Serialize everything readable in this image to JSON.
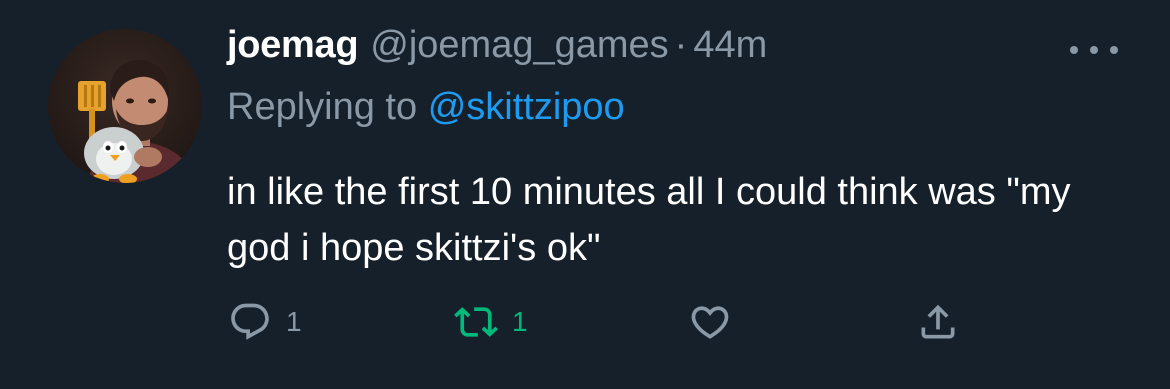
{
  "tweet": {
    "display_name": "joemag",
    "handle": "@joemag_games",
    "separator": "·",
    "time": "44m",
    "replying_prefix": "Replying to",
    "replying_to": "@skittzipoo",
    "text": "in like the first 10 minutes all I could think was \"my god i hope skittzi's ok\"",
    "reply_count": "1",
    "retweet_count": "1"
  },
  "icons": {
    "avatar": "avatar-photo",
    "more": "more-icon",
    "reply": "reply-icon",
    "retweet": "retweet-icon",
    "like": "heart-icon",
    "share": "share-icon"
  },
  "colors": {
    "background": "#15202b",
    "text_primary": "#ffffff",
    "text_secondary": "#8b98a5",
    "link": "#1d9bf0",
    "retweeted": "#00ba7c"
  }
}
